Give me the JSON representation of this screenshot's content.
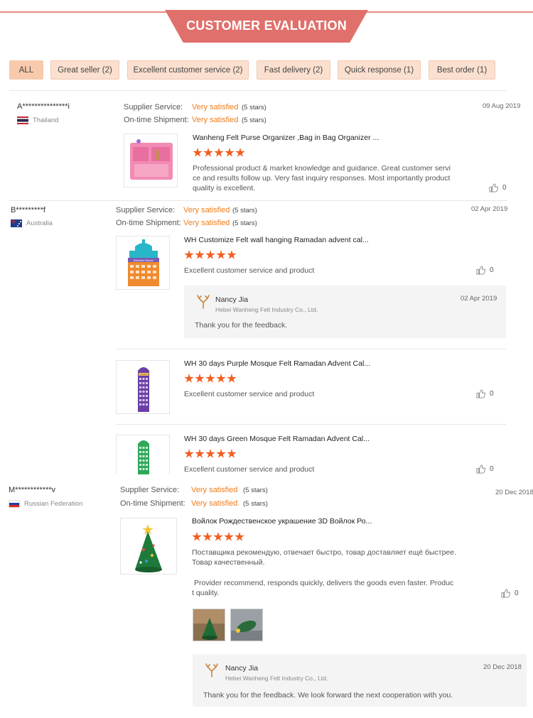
{
  "header": {
    "title": "CUSTOMER EVALUATION"
  },
  "filters": [
    {
      "label": "ALL",
      "active": true
    },
    {
      "label": "Great seller (2)"
    },
    {
      "label": "Excellent customer service (2)"
    },
    {
      "label": "Fast delivery (2)"
    },
    {
      "label": "Quick response (1)"
    },
    {
      "label": "Best order (1)"
    }
  ],
  "colors": {
    "banner": "#e0706b",
    "accent_orange": "#ef7c1b",
    "star": "#ef5f22",
    "chip": "#fbe0cf"
  },
  "reviews": [
    {
      "user": "A***************i",
      "country": "Thailand",
      "date": "09 Aug 2019",
      "supplier_label": "Supplier Service:",
      "supplier_value": "Very satisfied",
      "supplier_stars": "(5 stars)",
      "shipment_label": "On-time Shipment:",
      "shipment_value": "Very satisfied",
      "shipment_stars": "(5 stars)",
      "products": [
        {
          "title": "Wanheng Felt Purse Organizer ,Bag in Bag Organizer ...",
          "rating": 5,
          "text_lines": [
            "Professional product & market knowledge and guidance. Great customer servi",
            "ce and results follow up. Very fast inquiry responses. Most importantly product",
            "quality is excellent."
          ],
          "likes": "0"
        }
      ]
    },
    {
      "user": "B*********f",
      "country": "Australia",
      "date": "02 Apr 2019",
      "supplier_label": "Supplier Service:",
      "supplier_value": "Very satisfied",
      "supplier_stars": "(5 stars)",
      "shipment_label": "On-time Shipment:",
      "shipment_value": "Very satisfied",
      "shipment_stars": "(5 stars)",
      "products": [
        {
          "title": "WH Customize Felt wall hanging Ramadan advent cal...",
          "rating": 5,
          "text": "Excellent customer service and product",
          "likes": "0",
          "thumb_label": "Ramadan Kareem",
          "reply": {
            "name": "Nancy Jia",
            "company": "Hebei Wanheng Felt Industry Co., Ltd.",
            "date": "02 Apr 2019",
            "text": "Thank you for the feedback."
          }
        },
        {
          "title": "WH 30 days Purple Mosque Felt Ramadan Advent Cal...",
          "rating": 5,
          "text": "Excellent customer service and product",
          "likes": "0",
          "thumb_label": "Ramadan"
        },
        {
          "title": "WH 30 days Green Mosque Felt Ramadan Advent Cal...",
          "rating": 5,
          "text": "Excellent customer service and product",
          "likes": "0"
        }
      ]
    },
    {
      "user": "M************v",
      "country": "Russian Federation",
      "date": "20 Dec 2018",
      "supplier_label": "Supplier Service:",
      "supplier_value": "Very satisfied",
      "supplier_stars": "(5 stars)",
      "shipment_label": "On-time Shipment:",
      "shipment_value": "Very satisfied",
      "shipment_stars": "(5 stars)",
      "products": [
        {
          "title": "Войлок Рождественское украшение 3D Войлок Ро...",
          "rating": 5,
          "text_lines_ru": [
            "Поставщика рекомендую, отвечает быстро, товар доставляет ещё быстрее.",
            "Товар качественный."
          ],
          "text_lines_en": [
            "Provider recommend, responds quickly, delivers the goods even faster. Produc",
            "t quality."
          ],
          "likes": "0",
          "reply": {
            "name": "Nancy Jia",
            "company": "Hebei Wanheng Felt Industry Co., Ltd.",
            "date": "20 Dec 2018",
            "text": "Thank you for the feedback. We look forward the next cooperation with you."
          }
        }
      ]
    }
  ]
}
